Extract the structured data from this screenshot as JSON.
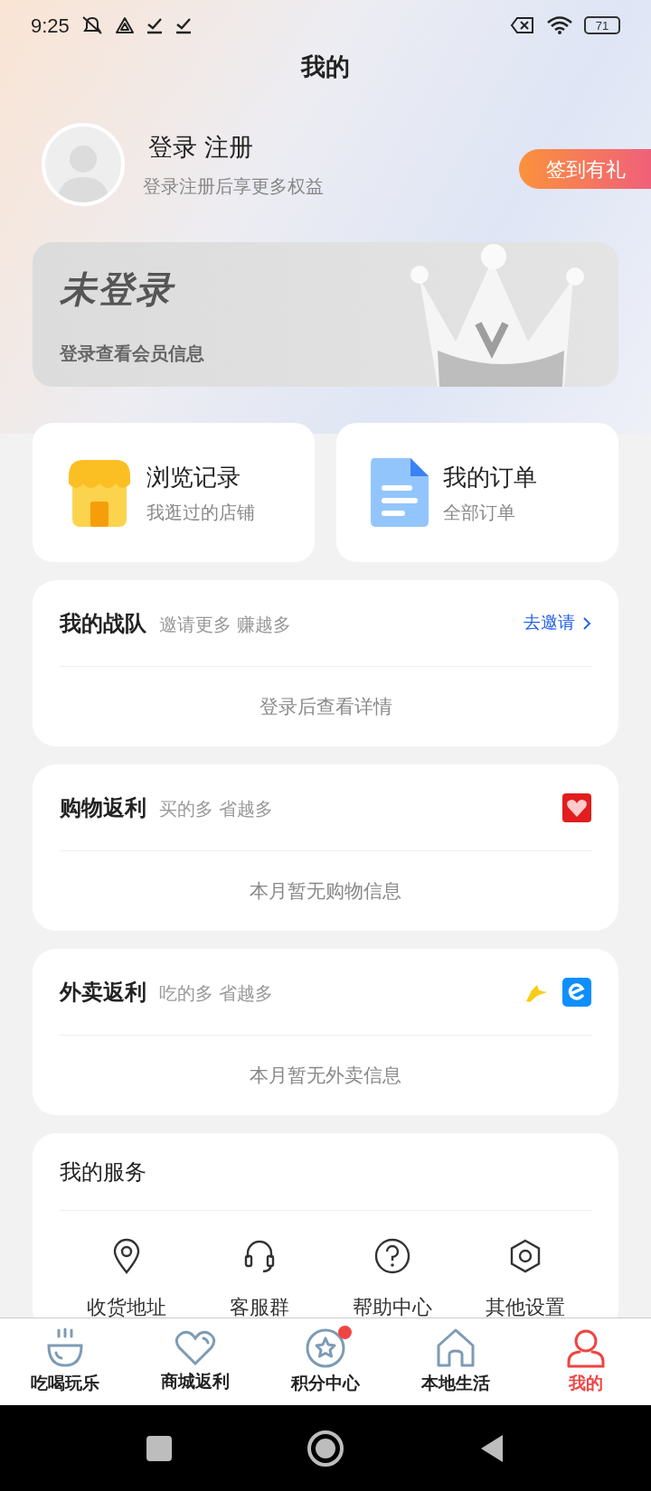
{
  "status_bar": {
    "time": "9:25",
    "battery": "71"
  },
  "header": {
    "title": "我的"
  },
  "profile": {
    "login": "登录 注册",
    "subtitle": "登录注册后享更多权益",
    "checkin_button": "签到有礼"
  },
  "member_card": {
    "title": "未登录",
    "subtitle": "登录查看会员信息"
  },
  "quick_cards": [
    {
      "kind": "shop",
      "title": "浏览记录",
      "subtitle": "我逛过的店铺"
    },
    {
      "kind": "document",
      "title": "我的订单",
      "subtitle": "全部订单"
    }
  ],
  "sections": [
    {
      "kind": "team",
      "title": "我的战队",
      "subtitle": "邀请更多 赚越多",
      "action": "去邀请",
      "empty_text": "登录后查看详情"
    },
    {
      "kind": "shopping",
      "title": "购物返利",
      "subtitle": "买的多 省越多",
      "empty_text": "本月暂无购物信息"
    },
    {
      "kind": "food",
      "title": "外卖返利",
      "subtitle": "吃的多 省越多",
      "empty_text": "本月暂无外卖信息"
    }
  ],
  "services": {
    "title": "我的服务",
    "items": [
      {
        "kind": "location",
        "label": "收货地址"
      },
      {
        "kind": "headset",
        "label": "客服群"
      },
      {
        "kind": "help",
        "label": "帮助中心"
      },
      {
        "kind": "settings",
        "label": "其他设置"
      }
    ]
  },
  "tabs": [
    {
      "kind": "bowl",
      "label": "吃喝玩乐",
      "selected": false,
      "badge": false
    },
    {
      "kind": "heart",
      "label": "商城返利",
      "selected": false,
      "badge": false
    },
    {
      "kind": "star",
      "label": "积分中心",
      "selected": false,
      "badge": true
    },
    {
      "kind": "home",
      "label": "本地生活",
      "selected": false,
      "badge": false
    },
    {
      "kind": "person",
      "label": "我的",
      "selected": true,
      "badge": false
    }
  ]
}
